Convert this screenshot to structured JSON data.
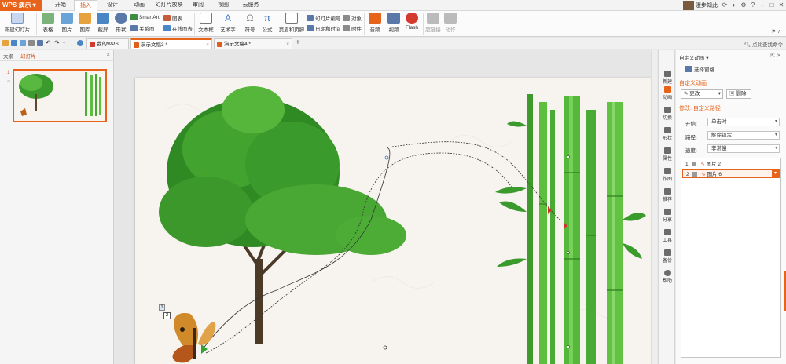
{
  "titlebar": {
    "app_name": "WPS 演示",
    "tabs": [
      "开始",
      "插入",
      "设计",
      "动画",
      "幻灯片放映",
      "审阅",
      "视图",
      "云服务"
    ],
    "active_tab_index": 1,
    "user_name": "漫步知此"
  },
  "ribbon": {
    "new_slide": "新建幻灯片",
    "table": "表格",
    "picture": "图片",
    "gallery": "图库",
    "screenshot": "截屏",
    "shape": "形状",
    "smartart": "SmartArt",
    "relation": "关系图",
    "chart": "图表",
    "online_chart": "在线图表",
    "textbox": "文本框",
    "wordart": "艺术字",
    "symbol": "符号",
    "formula": "公式",
    "header_footer": "页眉和页脚",
    "slide_number": "幻灯片编号",
    "object": "对象",
    "datetime": "日期和时间",
    "attachment": "附件",
    "audio": "音频",
    "video": "视频",
    "flash": "Flash",
    "hyperlink": "超链接",
    "action": "动作"
  },
  "tabbar": {
    "tabs": [
      {
        "label": "我的WPS"
      },
      {
        "label": "演示文稿3 *"
      },
      {
        "label": "演示文稿4 *"
      }
    ],
    "add": "+",
    "search": "点此查找命令"
  },
  "left_panel": {
    "tab_outline": "大纲",
    "tab_slides": "幻灯片",
    "slide_number": "1"
  },
  "slide": {
    "tag_1": "1",
    "tag_2": "2"
  },
  "sidebar": {
    "items": [
      "新建",
      "动画",
      "切换",
      "形状",
      "属性",
      "作图",
      "推荐",
      "分享",
      "工具",
      "备份",
      "帮助"
    ]
  },
  "right_panel": {
    "title": "自定义动画 ▾",
    "select_pane": "选择窗格",
    "section_custom": "自定义动画",
    "change_btn": "更改",
    "delete_btn": "删除",
    "modify_heading": "修改: 自定义路径",
    "start_label": "开始:",
    "start_value": "单击时",
    "path_label": "路径:",
    "path_value": "解除锁定",
    "speed_label": "速度:",
    "speed_value": "非常慢",
    "anim_items": [
      {
        "num": "1",
        "label": "图片 2"
      },
      {
        "num": "2",
        "label": "图片 6"
      }
    ]
  },
  "colors": {
    "accent": "#e8631a",
    "tree_green": "#3a9a2c",
    "bamboo_green": "#4cae36"
  }
}
